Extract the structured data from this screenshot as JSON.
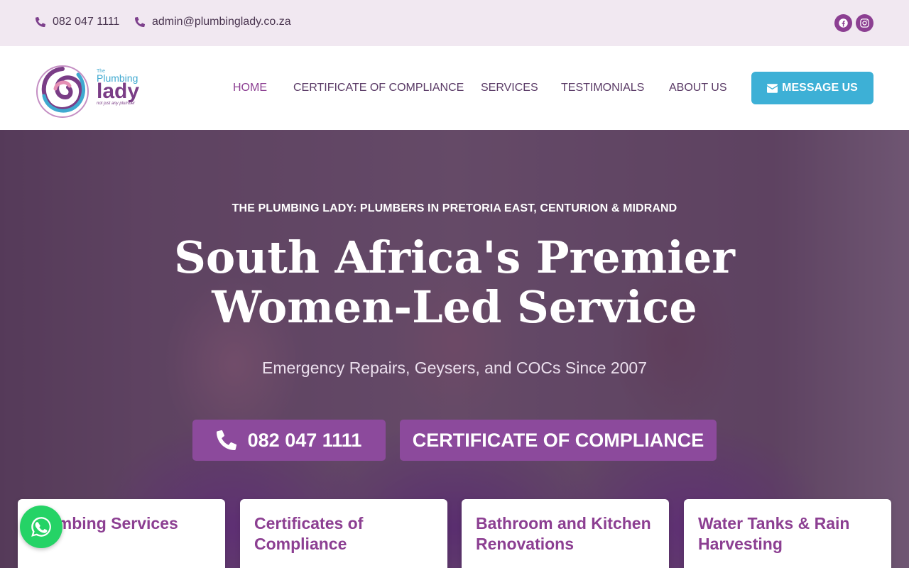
{
  "topbar": {
    "phone": "082 047 1111",
    "email": "admin@plumbinglady.co.za",
    "social": [
      {
        "icon": "facebook-icon"
      },
      {
        "icon": "instagram-icon"
      }
    ]
  },
  "logo": {
    "the": "The",
    "plumbing": "Plumbing",
    "lady": "lady",
    "tagline": "not just any plumber"
  },
  "nav": {
    "items": [
      {
        "label": "HOME",
        "active": true
      },
      {
        "label": "CERTIFICATE OF COMPLIANCE",
        "active": false
      },
      {
        "label": "SERVICES",
        "active": false
      },
      {
        "label": "TESTIMONIALS",
        "active": false
      },
      {
        "label": "ABOUT US",
        "active": false
      }
    ],
    "cta": "MESSAGE US"
  },
  "hero": {
    "eyebrow": "THE PLUMBING LADY: PLUMBERS IN PRETORIA EAST, CENTURION & MIDRAND",
    "title_line1": "South Africa's Premier",
    "title_line2": "Women-Led Service",
    "subtitle": "Emergency Repairs, Geysers, and COCs Since 2007",
    "phone_button": "082 047 1111",
    "coc_button": "CERTIFICATE OF COMPLIANCE"
  },
  "cards": [
    {
      "title": "Plumbing Services"
    },
    {
      "title": "Certificates of Compliance"
    },
    {
      "title": "Bathroom and Kitchen Renovations"
    },
    {
      "title": "Water Tanks & Rain Harvesting"
    }
  ],
  "colors": {
    "brand_purple": "#8c3f92",
    "accent_blue": "#3db0d6",
    "topbar_bg": "#f1e8f1",
    "whatsapp_green": "#25d366"
  }
}
